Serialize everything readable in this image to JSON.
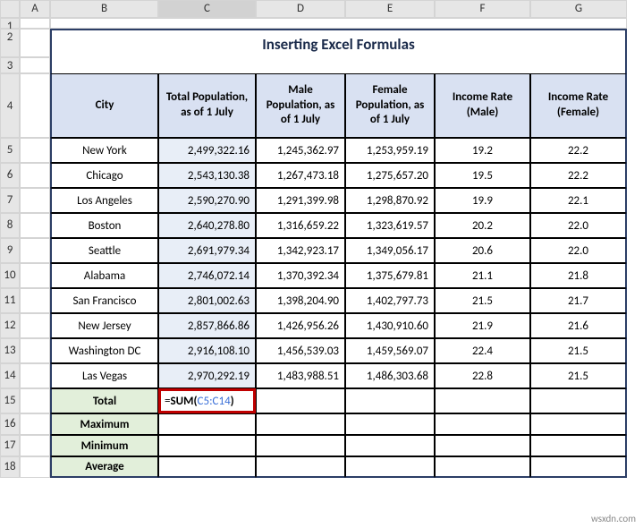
{
  "columns": [
    "A",
    "B",
    "C",
    "D",
    "E",
    "F",
    "G"
  ],
  "selected_column": "C",
  "rows": [
    "1",
    "2",
    "3",
    "4",
    "5",
    "6",
    "7",
    "8",
    "9",
    "10",
    "11",
    "12",
    "13",
    "14",
    "15",
    "16",
    "17",
    "18"
  ],
  "title": "Inserting Excel Formulas",
  "headers": {
    "city": "City",
    "total_pop": "Total Population, as of 1 July",
    "male_pop": "Male Population, as of 1 July",
    "female_pop": "Female Population, as of 1 July",
    "income_male": "Income Rate (Male)",
    "income_female": "Income Rate (Female)"
  },
  "data": [
    {
      "city": "New York",
      "total": "2,499,322.16",
      "male": "1,245,362.97",
      "female": "1,253,959.19",
      "im": "19.2",
      "if": "22.2"
    },
    {
      "city": "Chicago",
      "total": "2,543,130.38",
      "male": "1,267,473.18",
      "female": "1,275,657.20",
      "im": "19.5",
      "if": "22.2"
    },
    {
      "city": "Los Angeles",
      "total": "2,590,270.90",
      "male": "1,291,399.98",
      "female": "1,298,870.92",
      "im": "19.9",
      "if": "22.1"
    },
    {
      "city": "Boston",
      "total": "2,640,278.80",
      "male": "1,316,659.22",
      "female": "1,323,619.57",
      "im": "20.2",
      "if": "22.0"
    },
    {
      "city": "Seattle",
      "total": "2,691,979.34",
      "male": "1,342,923.17",
      "female": "1,349,056.17",
      "im": "20.6",
      "if": "22.0"
    },
    {
      "city": "Alabama",
      "total": "2,746,072.14",
      "male": "1,370,392.34",
      "female": "1,375,679.81",
      "im": "21.1",
      "if": "21.8"
    },
    {
      "city": "San Francisco",
      "total": "2,801,002.63",
      "male": "1,398,204.90",
      "female": "1,402,797.73",
      "im": "21.5",
      "if": "21.7"
    },
    {
      "city": "New Jersey",
      "total": "2,857,866.86",
      "male": "1,426,956.26",
      "female": "1,430,910.60",
      "im": "21.9",
      "if": "21.6"
    },
    {
      "city": "Washington DC",
      "total": "2,916,108.10",
      "male": "1,456,539.03",
      "female": "1,459,569.07",
      "im": "22.4",
      "if": "21.5"
    },
    {
      "city": "Las Vegas",
      "total": "2,970,292.19",
      "male": "1,483,988.51",
      "female": "1,486,303.68",
      "im": "22.8",
      "if": "21.5"
    }
  ],
  "summary": {
    "total": "Total",
    "maximum": "Maximum",
    "minimum": "Minimum",
    "average": "Average"
  },
  "formula": {
    "prefix": "=",
    "fn": "SUM",
    "open": "(",
    "ref": "C5:C14",
    "close": ")"
  },
  "watermark": "wsxdn.com"
}
